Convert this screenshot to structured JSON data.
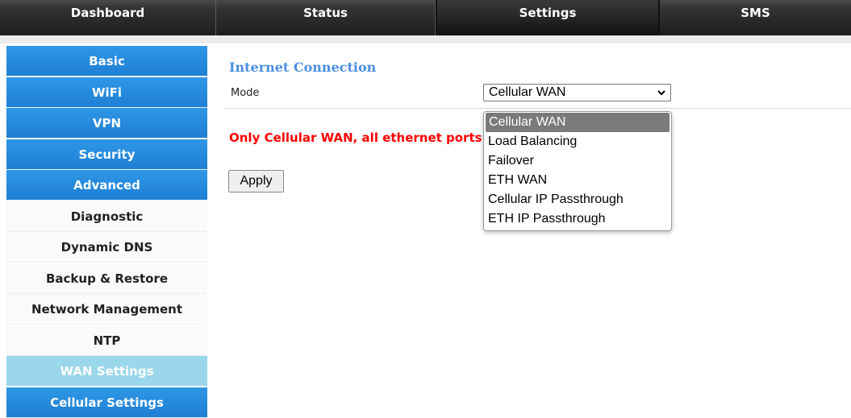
{
  "topnav": {
    "tabs": [
      {
        "label": "Dashboard"
      },
      {
        "label": "Status"
      },
      {
        "label": "Settings"
      },
      {
        "label": "SMS"
      }
    ],
    "active": "Settings"
  },
  "sidebar": {
    "items": [
      {
        "label": "Basic"
      },
      {
        "label": "WiFi"
      },
      {
        "label": "VPN"
      },
      {
        "label": "Security"
      },
      {
        "label": "Advanced"
      },
      {
        "label": "Diagnostic"
      },
      {
        "label": "Dynamic DNS"
      },
      {
        "label": "Backup & Restore"
      },
      {
        "label": "Network Management"
      },
      {
        "label": "NTP"
      },
      {
        "label": "WAN Settings"
      },
      {
        "label": "Cellular Settings"
      }
    ]
  },
  "main": {
    "section_title": "Internet Connection",
    "mode_label": "Mode",
    "mode_value": "Cellular WAN",
    "warning": "Only Cellular WAN, all ethernet ports",
    "apply_label": "Apply"
  },
  "dropdown": {
    "options": [
      "Cellular WAN",
      "Load Balancing",
      "Failover",
      "ETH WAN",
      "Cellular IP Passthrough",
      "ETH IP Passthrough"
    ],
    "selected": "Cellular WAN"
  },
  "colors": {
    "accent_blue": "#1f7fd4",
    "highlight_cyan": "#9ad7ea",
    "title_blue": "#4a8fe0",
    "warning_red": "#ff0000"
  }
}
